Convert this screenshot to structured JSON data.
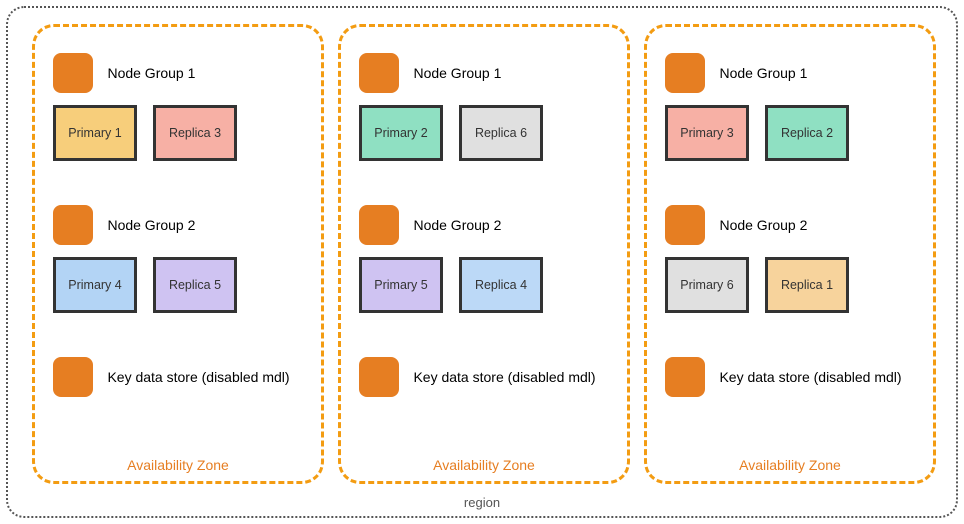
{
  "region_label": "region",
  "az_label": "Availability Zone",
  "zones": [
    {
      "groups": [
        {
          "label": "Node Group 1",
          "nodes": [
            {
              "label": "Primary 1",
              "color": "c-gold"
            },
            {
              "label": "Replica 3",
              "color": "c-pink"
            }
          ]
        },
        {
          "label": "Node Group 2",
          "nodes": [
            {
              "label": "Primary 4",
              "color": "c-blue"
            },
            {
              "label": "Replica 5",
              "color": "c-purple"
            }
          ]
        },
        {
          "label": "Key data store (disabled mdl)",
          "nodes": []
        }
      ]
    },
    {
      "groups": [
        {
          "label": "Node Group 1",
          "nodes": [
            {
              "label": "Primary 2",
              "color": "c-teal"
            },
            {
              "label": "Replica 6",
              "color": "c-gray"
            }
          ]
        },
        {
          "label": "Node Group 2",
          "nodes": [
            {
              "label": "Primary 5",
              "color": "c-purple"
            },
            {
              "label": "Replica 4",
              "color": "c-bluea"
            }
          ]
        },
        {
          "label": "Key data store (disabled mdl)",
          "nodes": []
        }
      ]
    },
    {
      "groups": [
        {
          "label": "Node Group 1",
          "nodes": [
            {
              "label": "Primary 3",
              "color": "c-pink"
            },
            {
              "label": "Replica 2",
              "color": "c-teal"
            }
          ]
        },
        {
          "label": "Node Group 2",
          "nodes": [
            {
              "label": "Primary 6",
              "color": "c-gray"
            },
            {
              "label": "Replica 1",
              "color": "c-peach"
            }
          ]
        },
        {
          "label": "Key data store (disabled mdl)",
          "nodes": []
        }
      ]
    }
  ]
}
